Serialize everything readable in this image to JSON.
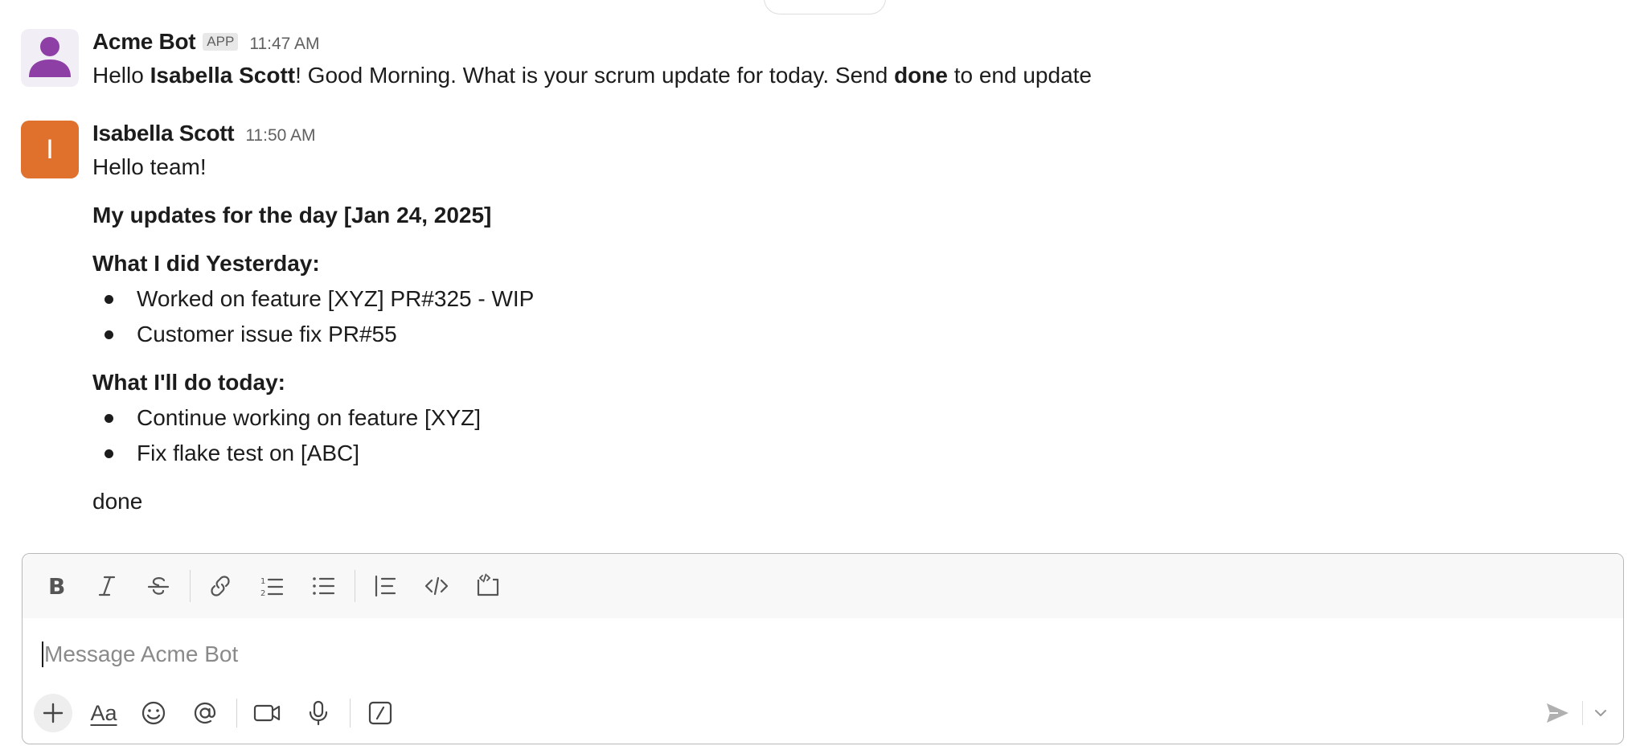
{
  "messages": {
    "bot": {
      "sender": "Acme Bot",
      "badge": "APP",
      "time": "11:47 AM",
      "text_parts": [
        "Hello ",
        "Isabella Scott",
        "! Good Morning. What is your scrum update for today. Send ",
        "done",
        " to end update"
      ]
    },
    "user": {
      "sender": "Isabella Scott",
      "avatar_letter": "I",
      "time": "11:50 AM",
      "greeting": "Hello team!",
      "heading": "My updates for the day [Jan 24, 2025]",
      "yesterday_title": "What I did Yesterday:",
      "yesterday_items": [
        "Worked on feature [XYZ] PR#325 - WIP",
        "Customer issue fix PR#55"
      ],
      "today_title": "What I'll do today:",
      "today_items": [
        "Continue working on feature [XYZ]",
        "Fix flake test on [ABC]"
      ],
      "closing": "done"
    }
  },
  "composer": {
    "placeholder": "Message Acme Bot",
    "format_icons": [
      "bold-icon",
      "italic-icon",
      "strikethrough-icon",
      "link-icon",
      "ordered-list-icon",
      "bulleted-list-icon",
      "blockquote-icon",
      "code-icon",
      "code-block-icon"
    ],
    "action_icons": [
      "plus-icon",
      "formatting-toggle-icon",
      "emoji-icon",
      "mention-icon",
      "video-icon",
      "microphone-icon",
      "shortcuts-icon",
      "send-icon",
      "chevron-down-icon"
    ],
    "format_toggle_label": "Aa"
  },
  "colors": {
    "avatar_user": "#e0712d",
    "avatar_bot_figure": "#8e3fa6",
    "text": "#1d1c1d",
    "muted": "#616061"
  }
}
